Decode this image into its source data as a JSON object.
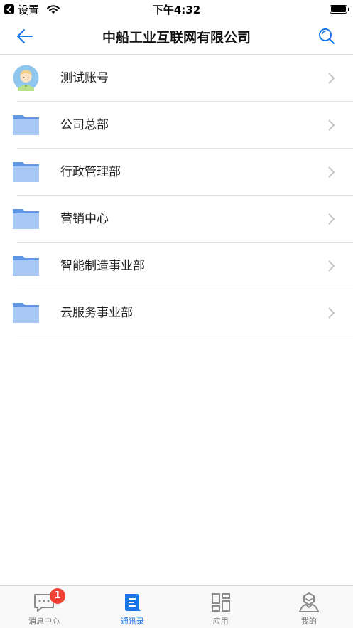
{
  "status_bar": {
    "back_app_label": "设置",
    "time": "下午4:32"
  },
  "nav": {
    "title": "中船工业互联网有限公司",
    "back_icon": "back-arrow-icon",
    "search_icon": "search-icon"
  },
  "list": {
    "items": [
      {
        "label": "测试账号",
        "icon": "avatar"
      },
      {
        "label": "公司总部",
        "icon": "folder-icon"
      },
      {
        "label": "行政管理部",
        "icon": "folder-icon"
      },
      {
        "label": "营销中心",
        "icon": "folder-icon"
      },
      {
        "label": "智能制造事业部",
        "icon": "folder-icon"
      },
      {
        "label": "云服务事业部",
        "icon": "folder-icon"
      }
    ]
  },
  "tabbar": {
    "tabs": [
      {
        "label": "消息中心",
        "icon": "message-icon",
        "badge": "1",
        "active": false
      },
      {
        "label": "通讯录",
        "icon": "contacts-icon",
        "active": true
      },
      {
        "label": "应用",
        "icon": "apps-icon",
        "active": false
      },
      {
        "label": "我的",
        "icon": "profile-icon",
        "active": false
      }
    ]
  },
  "colors": {
    "accent": "#1976e8",
    "folder": "#a9c8f5",
    "folder_tab": "#5f97e3",
    "badge": "#f04134"
  }
}
